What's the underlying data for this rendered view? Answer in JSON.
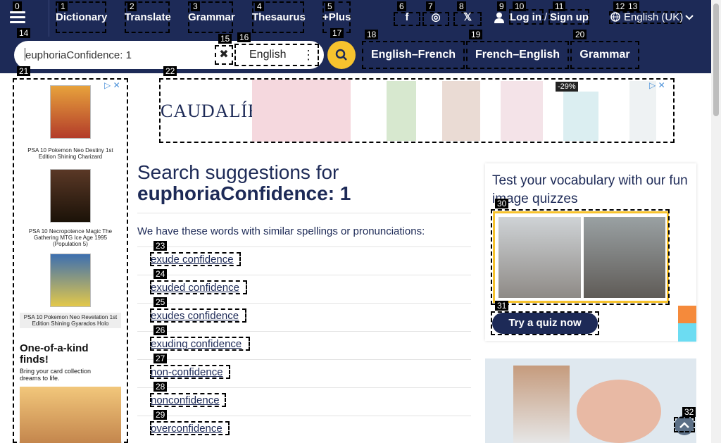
{
  "nav": {
    "items": [
      {
        "label": "Dictionary",
        "marker": "1"
      },
      {
        "label": "Translate",
        "marker": "2"
      },
      {
        "label": "Grammar",
        "marker": "3"
      },
      {
        "label": "Thesaurus",
        "marker": "4"
      },
      {
        "label": "+Plus",
        "marker": "5"
      }
    ],
    "menu_marker": "0",
    "social": [
      {
        "icon": "facebook-icon",
        "glyph": "f",
        "marker": "6"
      },
      {
        "icon": "instagram-icon",
        "glyph": "◎",
        "marker": "7"
      },
      {
        "icon": "x-twitter-icon",
        "glyph": "𝕏",
        "marker": "8"
      }
    ],
    "user_marker": "9",
    "login_label": "Log in",
    "login_marker": "10",
    "login_separator": "/",
    "signup_label": "Sign up",
    "signup_marker": "11",
    "globe_marker": "12",
    "language_label": "English (UK)",
    "language_marker": "13"
  },
  "search": {
    "marker": "14",
    "value": "euphoriaConfidence: 1",
    "clear_marker": "15",
    "language": "English",
    "language_marker": "16",
    "submit_marker": "17"
  },
  "dict_tabs": [
    {
      "label": "English–French",
      "marker": "18"
    },
    {
      "label": "French–English",
      "marker": "19"
    },
    {
      "label": "Grammar",
      "marker": "20"
    }
  ],
  "ads": {
    "left_marker": "21",
    "top_marker": "22",
    "brand": "CAUDALÍE",
    "discount": "-29%",
    "cards": [
      "PSA 10 Pokemon Neo Destiny 1st Edition Shining Charizard",
      "PSA 10 Necropotence Magic The Gathering MTG Ice Age 1995 (Population 5)",
      "PSA 10 Pokemon Neo Revelation 1st Edition Shining Gyarados Holo"
    ],
    "promo_heading": "One-of-a-kind finds!",
    "promo_sub": "Bring your card collection dreams to life."
  },
  "main": {
    "title_prefix": "Search suggestions for",
    "title_term": "euphoriaConfidence: 1",
    "intro": "We have these words with similar spellings or pronunciations:",
    "suggestions": [
      {
        "text": "exude confidence",
        "marker": "23"
      },
      {
        "text": "exuded confidence",
        "marker": "24"
      },
      {
        "text": "exudes confidence",
        "marker": "25"
      },
      {
        "text": "exuding confidence",
        "marker": "26"
      },
      {
        "text": "non-confidence",
        "marker": "27"
      },
      {
        "text": "nonconfidence",
        "marker": "28"
      },
      {
        "text": "overconfidence",
        "marker": "29"
      }
    ]
  },
  "quiz": {
    "title": "Test your vocabulary with our fun image quizzes",
    "image_marker": "30",
    "button_label": "Try a quiz now",
    "button_marker": "31"
  },
  "scroll_top_marker": "32",
  "colors": {
    "nav_bg": "#1d2a57",
    "accent": "#f7c32e",
    "link": "#1d2a57"
  }
}
